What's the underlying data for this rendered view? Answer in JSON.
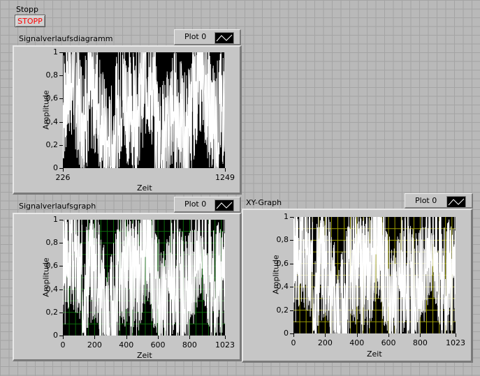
{
  "stop": {
    "label": "Stopp",
    "button": "STOPP"
  },
  "chart_data": [
    {
      "type": "line",
      "title": "Signalverlaufsdiagramm",
      "legend": "Plot 0",
      "xlabel": "Zeit",
      "ylabel": "Amplitude",
      "xlim": [
        226,
        1249
      ],
      "ylim": [
        0,
        1
      ],
      "xticks": [
        "226",
        "1249"
      ],
      "yticks": [
        "0",
        "0,2",
        "0,4",
        "0,6",
        "0,8",
        "1"
      ],
      "grid": false,
      "grid_color": "",
      "series": [
        {
          "name": "Plot 0",
          "color": "#ffffff",
          "description": "random values 0..1",
          "seed": 7
        }
      ]
    },
    {
      "type": "line",
      "title": "Signalverlaufsgraph",
      "legend": "Plot 0",
      "xlabel": "Zeit",
      "ylabel": "Amplitude",
      "xlim": [
        0,
        1023
      ],
      "ylim": [
        0,
        1
      ],
      "xticks": [
        "0",
        "200",
        "400",
        "600",
        "800",
        "1023"
      ],
      "yticks": [
        "0",
        "0,2",
        "0,4",
        "0,6",
        "0,8",
        "1"
      ],
      "grid": true,
      "grid_color": "#0b6a0b",
      "series": [
        {
          "name": "Plot 0",
          "color": "#ffffff",
          "seed": 3
        }
      ]
    },
    {
      "type": "line",
      "title": "XY-Graph",
      "legend": "Plot 0",
      "xlabel": "Zeit",
      "ylabel": "Amplitude",
      "xlim": [
        0,
        1023
      ],
      "ylim": [
        0,
        1
      ],
      "xticks": [
        "0",
        "200",
        "400",
        "600",
        "800",
        "1023"
      ],
      "yticks": [
        "0",
        "0,2",
        "0,4",
        "0,6",
        "0,8",
        "1"
      ],
      "grid": true,
      "grid_color": "#9a9a00",
      "series": [
        {
          "name": "Plot 0",
          "color": "#ffffff",
          "seed": 3
        }
      ]
    }
  ]
}
